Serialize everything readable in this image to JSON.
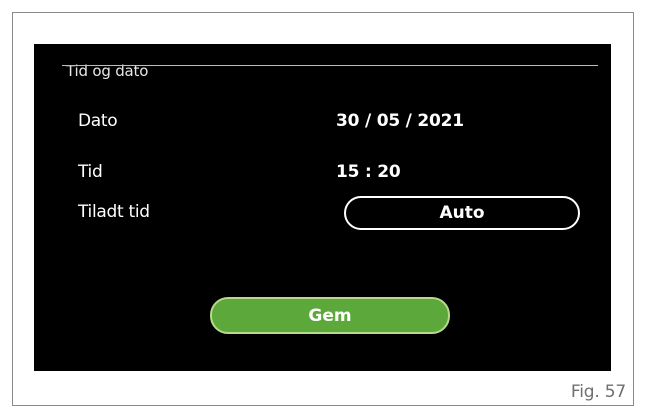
{
  "screen": {
    "title": "Tid og dato",
    "rows": [
      {
        "label": "Dato",
        "value": "30 / 05 / 2021"
      },
      {
        "label": "Tid",
        "value": "15 : 20"
      },
      {
        "label": "Tiladt tid",
        "value": "Auto"
      }
    ],
    "save_label": "Gem"
  },
  "caption": "Fig. 57",
  "colors": {
    "screen_background": "#000000",
    "text": "#ffffff",
    "save_button": "#5da83a"
  }
}
